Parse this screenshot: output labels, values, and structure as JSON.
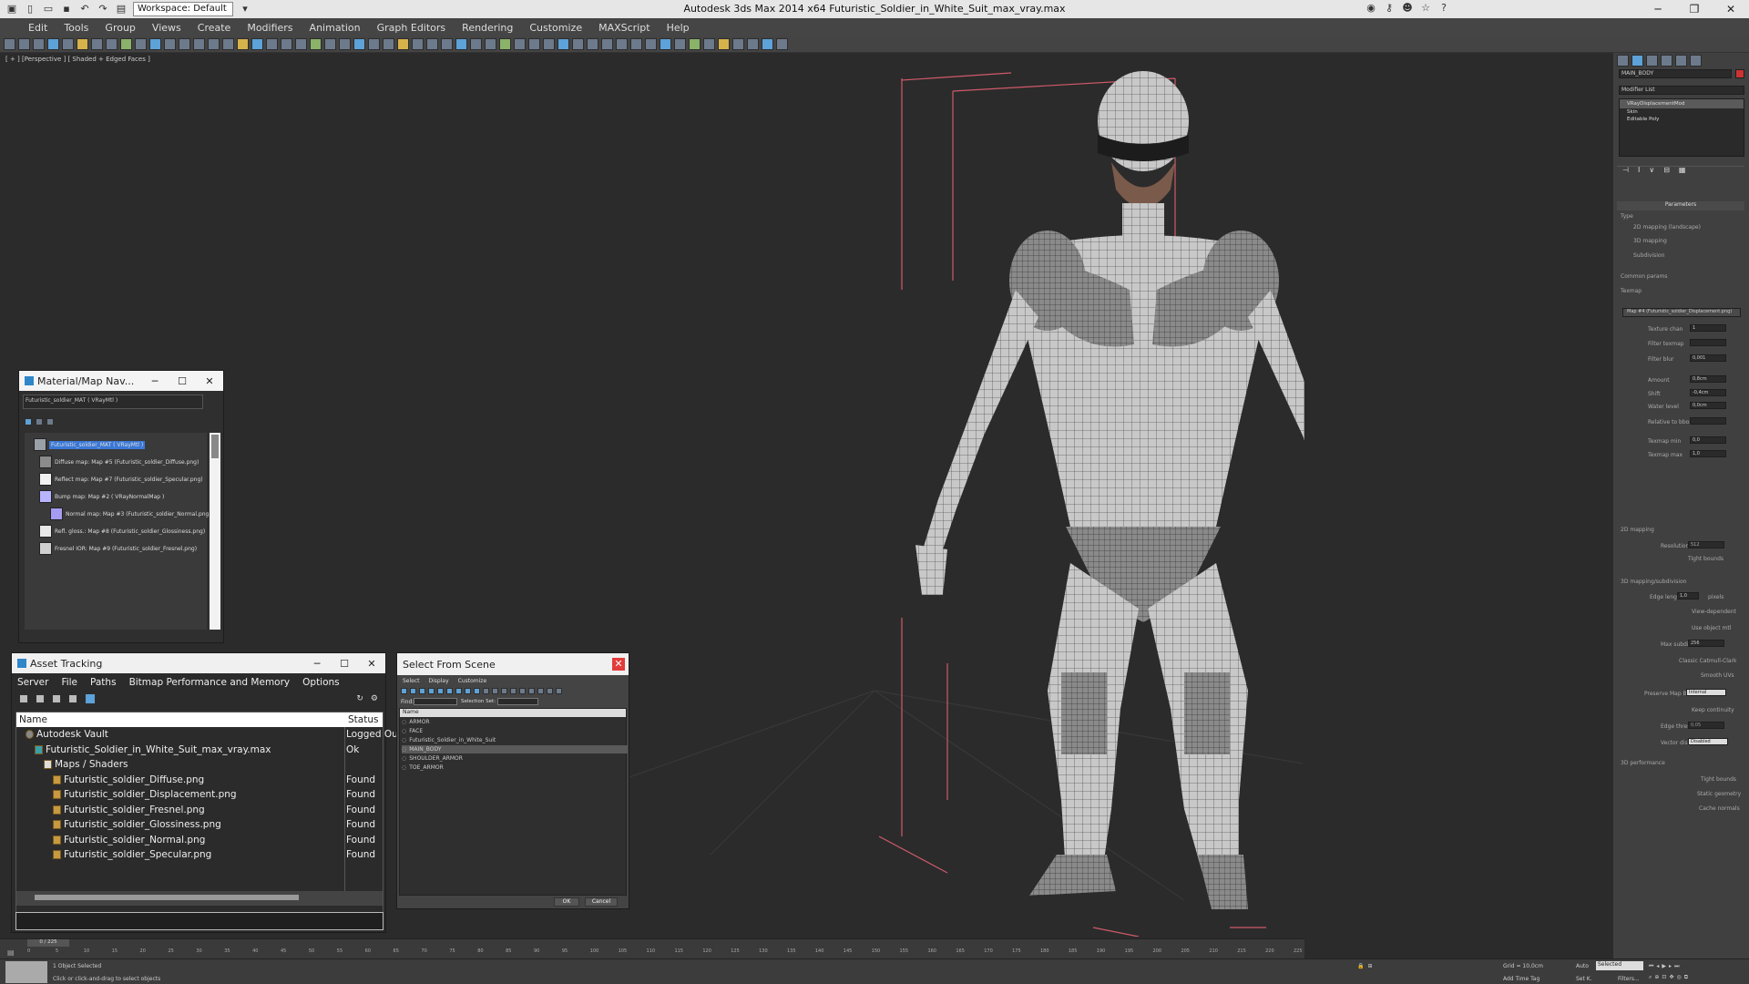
{
  "window": {
    "title": "Autodesk 3ds Max  2014 x64     Futuristic_Soldier_in_White_Suit_max_vray.max",
    "workspace": "Workspace: Default"
  },
  "menu": [
    "Edit",
    "Tools",
    "Group",
    "Views",
    "Create",
    "Modifiers",
    "Animation",
    "Graph Editors",
    "Rendering",
    "Customize",
    "MAXScript",
    "Help"
  ],
  "viewport": {
    "label": "[ + ] [Perspective ] [ Shaded + Edged Faces ]"
  },
  "command_panel": {
    "object_name": "MAIN_BODY",
    "modifier_list_label": "Modifier List",
    "stack": [
      "VRayDisplacementMod",
      "Skin",
      "Editable Poly"
    ],
    "rollout_title": "Parameters",
    "type_label": "Type",
    "type_options": [
      "2D mapping (landscape)",
      "3D mapping",
      "Subdivision"
    ],
    "common_params": "Common params",
    "texmap_label": "Texmap",
    "texmap_value": "Map #4 (Futuristic_soldier_Displacement.png)",
    "fields": [
      {
        "label": "Texture chan",
        "value": "1"
      },
      {
        "label": "Filter texmap",
        "value": ""
      },
      {
        "label": "Filter blur",
        "value": "0,001"
      },
      {
        "label": "Amount",
        "value": "0,8cm"
      },
      {
        "label": "Shift",
        "value": "-0,4cm"
      },
      {
        "label": "Water level",
        "value": "0,0cm"
      },
      {
        "label": "Relative to bbox",
        "value": ""
      },
      {
        "label": "Texmap min",
        "value": "0,0"
      },
      {
        "label": "Texmap max",
        "value": "1,0"
      }
    ],
    "mapping_2d": "2D mapping",
    "resolution": {
      "label": "Resolution",
      "value": "512"
    },
    "tight_bounds": "Tight bounds",
    "subdiv_label": "3D mapping/subdivision",
    "edge_length": {
      "label": "Edge length",
      "value": "1,0",
      "unit": "pixels"
    },
    "subdiv_options": [
      "View-dependent",
      "Use object mtl"
    ],
    "max_subdivs": {
      "label": "Max subdivs",
      "value": "256"
    },
    "subdiv_options2": [
      "Classic Catmull-Clark",
      "Smooth UVs"
    ],
    "preserve_map_bnd": {
      "label": "Preserve Map Bnd",
      "value": "Internal"
    },
    "keep_continuity": "Keep continuity",
    "edge_thresh": {
      "label": "Edge thresh",
      "value": "0,05"
    },
    "vector_disp": {
      "label": "Vector displ",
      "value": "Disabled"
    },
    "perf_label": "3D performance",
    "perf_options": [
      "Tight bounds",
      "Static geometry",
      "Cache normals"
    ]
  },
  "material_navigator": {
    "title": "Material/Map Nav...",
    "field": "Futuristic_soldier_MAT ( VRayMtl )",
    "items": [
      {
        "text": "Futuristic_soldier_MAT ( VRayMtl )",
        "selected": true,
        "swatch": "#9aa0a8"
      },
      {
        "text": "Diffuse map: Map #5 (Futuristic_soldier_Diffuse.png)",
        "selected": false,
        "swatch": "#8b8b8b"
      },
      {
        "text": "Reflect map: Map #7 (Futuristic_soldier_Specular.png)",
        "selected": false,
        "swatch": "#f2f2f2"
      },
      {
        "text": "Bump map: Map #2 ( VRayNormalMap )",
        "selected": false,
        "swatch": "#b9b4ff"
      },
      {
        "text": "Normal map: Map #3 (Futuristic_soldier_Normal.png)",
        "selected": false,
        "swatch": "#a49cf0"
      },
      {
        "text": "Refl. gloss.: Map #8 (Futuristic_soldier_Glossiness.png)",
        "selected": false,
        "swatch": "#e8e8e8"
      },
      {
        "text": "Fresnel IOR: Map #9 (Futuristic_soldier_Fresnel.png)",
        "selected": false,
        "swatch": "#d0d0d0"
      }
    ]
  },
  "asset_tracking": {
    "title": "Asset Tracking",
    "menu": [
      "Server",
      "File",
      "Paths",
      "Bitmap Performance and Memory",
      "Options"
    ],
    "columns": [
      "Name",
      "Status"
    ],
    "rows": [
      {
        "name": "Autodesk Vault",
        "status": "Logged Ou",
        "indent": 1,
        "icon": "vault"
      },
      {
        "name": "Futuristic_Soldier_in_White_Suit_max_vray.max",
        "status": "Ok",
        "indent": 2,
        "icon": "max"
      },
      {
        "name": "Maps / Shaders",
        "status": "",
        "indent": 3,
        "icon": "folder"
      },
      {
        "name": "Futuristic_soldier_Diffuse.png",
        "status": "Found",
        "indent": 4,
        "icon": "file"
      },
      {
        "name": "Futuristic_soldier_Displacement.png",
        "status": "Found",
        "indent": 4,
        "icon": "file"
      },
      {
        "name": "Futuristic_soldier_Fresnel.png",
        "status": "Found",
        "indent": 4,
        "icon": "file"
      },
      {
        "name": "Futuristic_soldier_Glossiness.png",
        "status": "Found",
        "indent": 4,
        "icon": "file"
      },
      {
        "name": "Futuristic_soldier_Normal.png",
        "status": "Found",
        "indent": 4,
        "icon": "file"
      },
      {
        "name": "Futuristic_soldier_Specular.png",
        "status": "Found",
        "indent": 4,
        "icon": "file"
      }
    ]
  },
  "select_from_scene": {
    "title": "Select From Scene",
    "menu": [
      "Select",
      "Display",
      "Customize"
    ],
    "find_label": "Find:",
    "selection_set_label": "Selection Set:",
    "column": "Name",
    "items": [
      {
        "name": "ARMOR",
        "selected": false
      },
      {
        "name": "FACE",
        "selected": false
      },
      {
        "name": "Futuristic_Soldier_in_White_Suit",
        "selected": false
      },
      {
        "name": "MAIN_BODY",
        "selected": true
      },
      {
        "name": "SHOULDER_ARMOR",
        "selected": false
      },
      {
        "name": "TOE_ARMOR",
        "selected": false
      }
    ],
    "ok": "OK",
    "cancel": "Cancel"
  },
  "timeline": {
    "frame": "0 / 225",
    "ticks": [
      "0",
      "5",
      "10",
      "15",
      "20",
      "25",
      "30",
      "35",
      "40",
      "45",
      "50",
      "55",
      "60",
      "65",
      "70",
      "75",
      "80",
      "85",
      "90",
      "95",
      "100",
      "105",
      "110",
      "115",
      "120",
      "125",
      "130",
      "135",
      "140",
      "145",
      "150",
      "155",
      "160",
      "165",
      "170",
      "175",
      "180",
      "185",
      "190",
      "195",
      "200",
      "205",
      "210",
      "215",
      "220",
      "225"
    ]
  },
  "status": {
    "selection": "1 Object Selected",
    "hint": "Click or click-and-drag to select objects",
    "grid": "Grid = 10,0cm",
    "add_time_tag": "Add Time Tag",
    "auto": "Auto",
    "selected": "Selected",
    "set_k": "Set K.",
    "filters": "Filters..."
  },
  "colors": {
    "selection_blue": "#3a78d6",
    "bbox_red": "#d05a6a",
    "dialog_close_red": "#e23b3b"
  }
}
